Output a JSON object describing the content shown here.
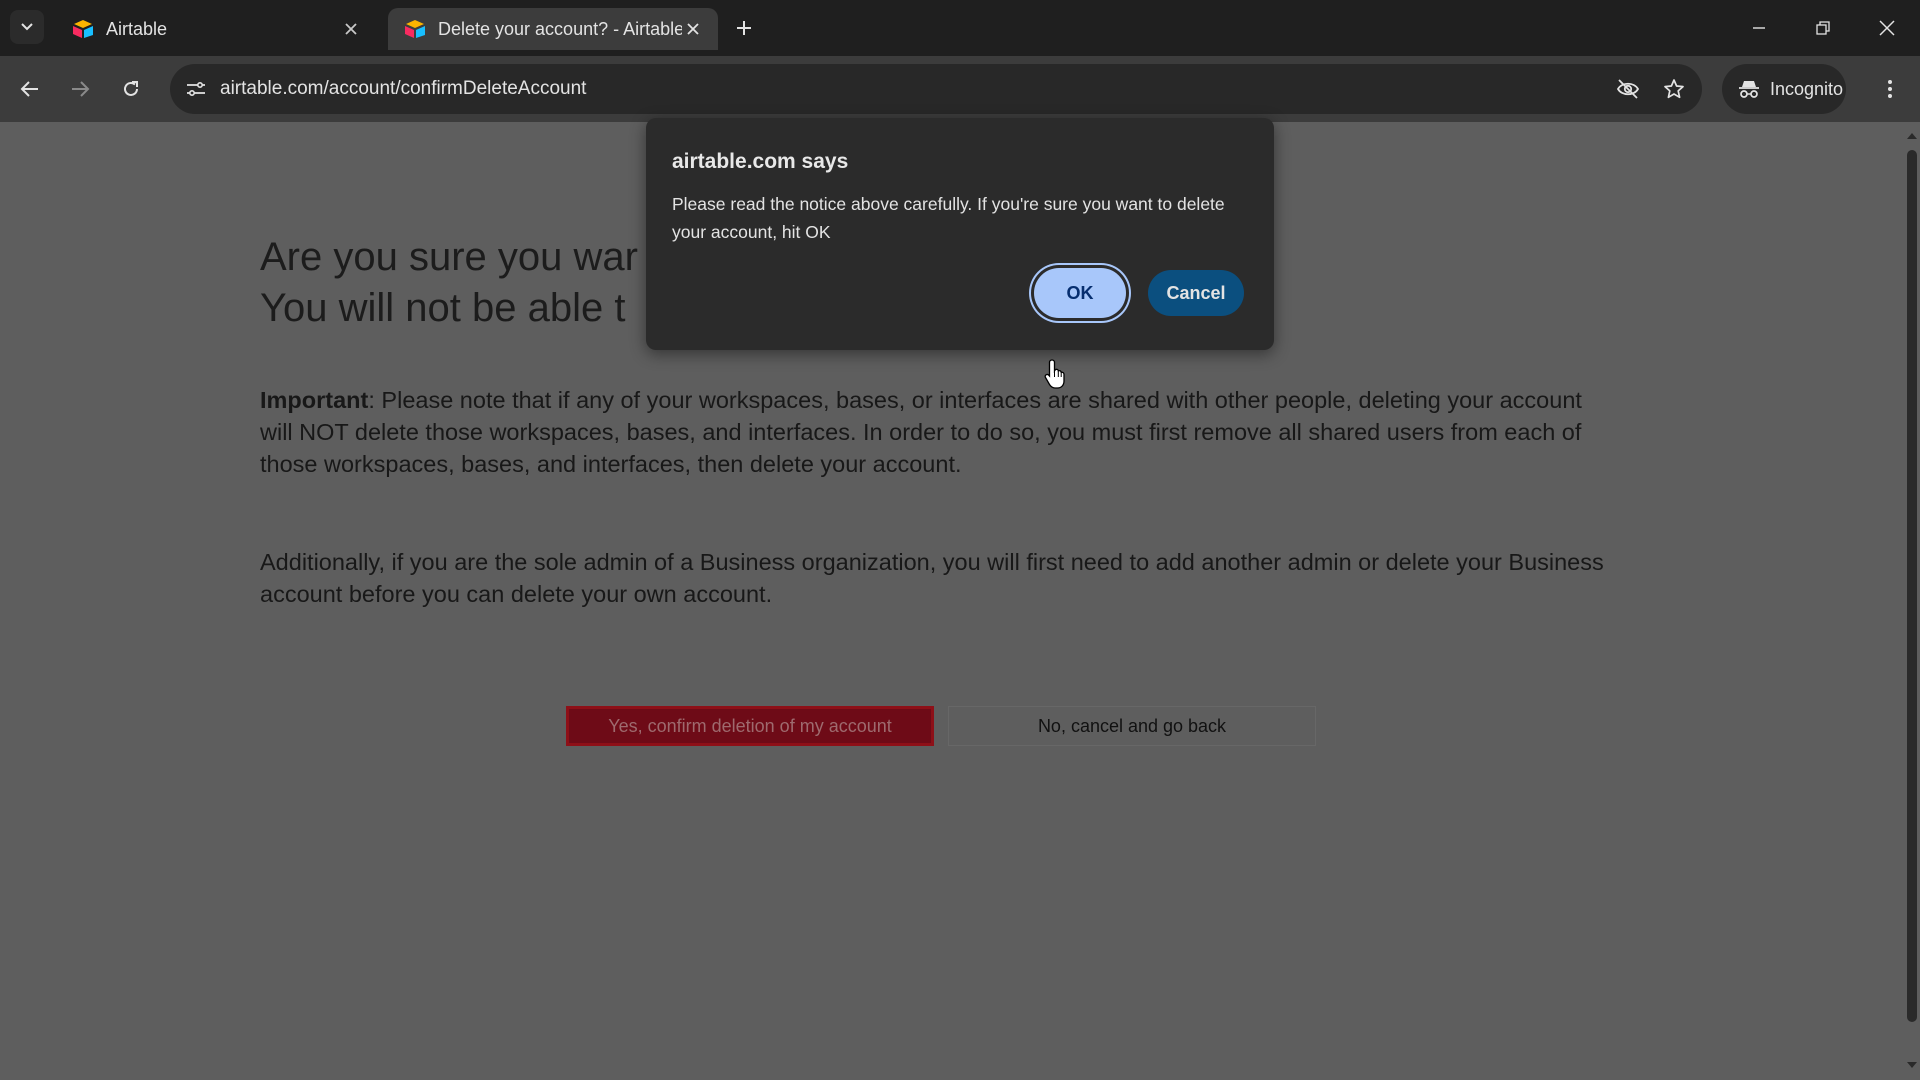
{
  "browser": {
    "tabs": [
      {
        "title": "Airtable",
        "active": false
      },
      {
        "title": "Delete your account? - Airtable",
        "active": true
      }
    ],
    "url": "airtable.com/account/confirmDeleteAccount",
    "profile_label": "Incognito",
    "icons": [
      "tab-search-icon",
      "favicon-airtable-icon",
      "close-icon",
      "plus-icon",
      "minimize-icon",
      "restore-icon",
      "back-icon",
      "forward-icon",
      "reload-icon",
      "site-info-icon",
      "eye-off-icon",
      "star-icon",
      "incognito-icon",
      "kebab-menu-icon"
    ]
  },
  "page": {
    "heading_line1": "Are you sure you war",
    "heading_line2": "You will not be able t",
    "important_label": "Important",
    "important_text": ": Please note that if any of your workspaces, bases, or interfaces are shared with other people, deleting your account will NOT delete those workspaces, bases, and interfaces. In order to do so, you must first remove all shared users from each of those workspaces, bases, and interfaces, then delete your account.",
    "additional_text": "Additionally, if you are the sole admin of a Business organization, you will first need to add another admin or delete your Business account before you can delete your own account.",
    "confirm_button": "Yes, confirm deletion of my account",
    "cancel_button": "No, cancel and go back"
  },
  "dialog": {
    "title": "airtable.com says",
    "message": "Please read the notice above carefully. If you're sure you want to delete your account, hit OK",
    "ok_label": "OK",
    "cancel_label": "Cancel"
  },
  "colors": {
    "tabbar": "#1f1f1f",
    "toolbar": "#3c3c3c",
    "page_dimmed": "#5e5e5e",
    "dialog_bg": "#2b2b2b",
    "ok_button": "#a8c7fa",
    "cancel_dialog_button": "#0b4f7f",
    "danger_button": "#6e0b17"
  }
}
